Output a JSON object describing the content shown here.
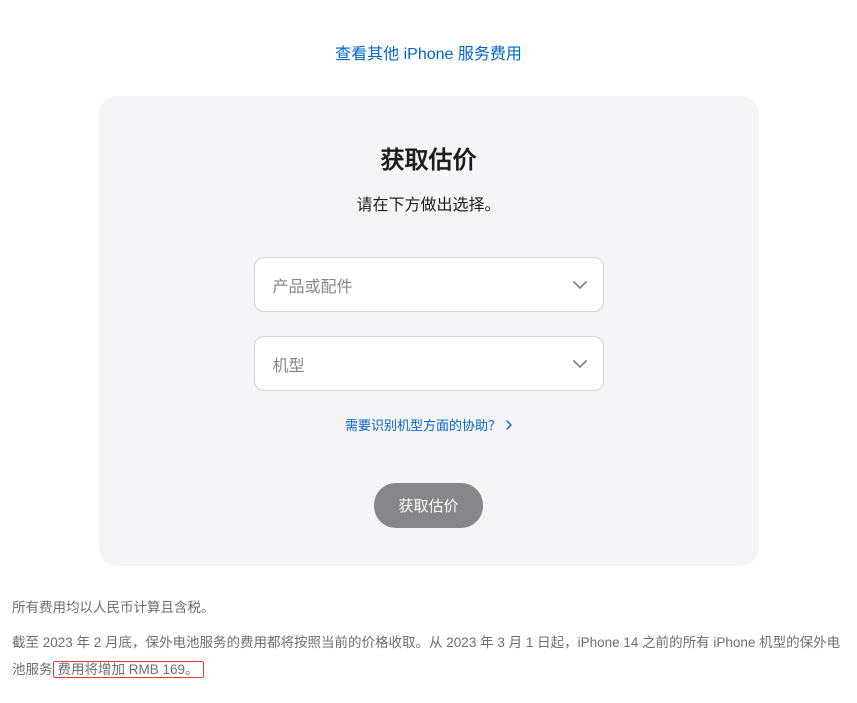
{
  "topLink": "查看其他 iPhone 服务费用",
  "card": {
    "title": "获取估价",
    "subtitle": "请在下方做出选择。",
    "select1": {
      "placeholder": "产品或配件"
    },
    "select2": {
      "placeholder": "机型"
    },
    "helpLink": "需要识别机型方面的协助？",
    "button": "获取估价"
  },
  "note1": "所有费用均以人民币计算且含税。",
  "note2_part1": "截至 2023 年 2 月底，保外电池服务的费用都将按照当前的价格收取。从 2023 年 3 月 1 日起，iPhone 14 之前的所有 iPhone 机型的保外电池服务",
  "note2_highlight": "费用将增加 RMB 169。"
}
